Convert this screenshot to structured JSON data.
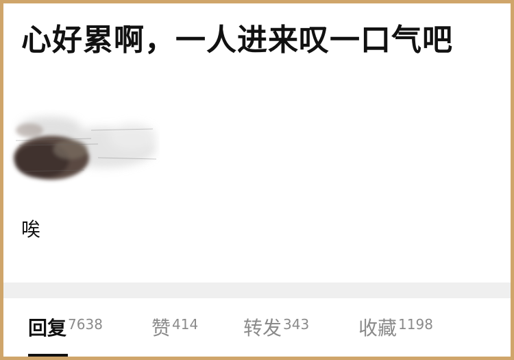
{
  "post": {
    "title": "心好累啊，一人进来叹一口气吧",
    "body": "唉"
  },
  "tabs": [
    {
      "label": "回复",
      "count": "7638",
      "active": true
    },
    {
      "label": "赞",
      "count": "414",
      "active": false
    },
    {
      "label": "转发",
      "count": "343",
      "active": false
    },
    {
      "label": "收藏",
      "count": "1198",
      "active": false
    }
  ],
  "colors": {
    "frame_border": "#cfa56a",
    "divider": "#efefef",
    "active_text": "#111111",
    "inactive_text": "#8a8a8a"
  }
}
